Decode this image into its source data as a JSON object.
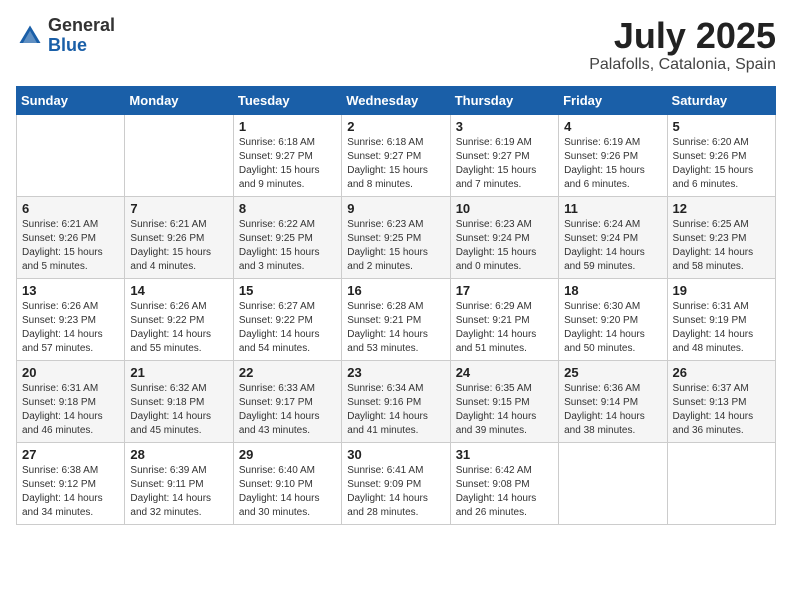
{
  "header": {
    "logo_general": "General",
    "logo_blue": "Blue",
    "month_title": "July 2025",
    "location": "Palafolls, Catalonia, Spain"
  },
  "weekdays": [
    "Sunday",
    "Monday",
    "Tuesday",
    "Wednesday",
    "Thursday",
    "Friday",
    "Saturday"
  ],
  "weeks": [
    [
      {
        "day": "",
        "info": ""
      },
      {
        "day": "",
        "info": ""
      },
      {
        "day": "1",
        "info": "Sunrise: 6:18 AM\nSunset: 9:27 PM\nDaylight: 15 hours\nand 9 minutes."
      },
      {
        "day": "2",
        "info": "Sunrise: 6:18 AM\nSunset: 9:27 PM\nDaylight: 15 hours\nand 8 minutes."
      },
      {
        "day": "3",
        "info": "Sunrise: 6:19 AM\nSunset: 9:27 PM\nDaylight: 15 hours\nand 7 minutes."
      },
      {
        "day": "4",
        "info": "Sunrise: 6:19 AM\nSunset: 9:26 PM\nDaylight: 15 hours\nand 6 minutes."
      },
      {
        "day": "5",
        "info": "Sunrise: 6:20 AM\nSunset: 9:26 PM\nDaylight: 15 hours\nand 6 minutes."
      }
    ],
    [
      {
        "day": "6",
        "info": "Sunrise: 6:21 AM\nSunset: 9:26 PM\nDaylight: 15 hours\nand 5 minutes."
      },
      {
        "day": "7",
        "info": "Sunrise: 6:21 AM\nSunset: 9:26 PM\nDaylight: 15 hours\nand 4 minutes."
      },
      {
        "day": "8",
        "info": "Sunrise: 6:22 AM\nSunset: 9:25 PM\nDaylight: 15 hours\nand 3 minutes."
      },
      {
        "day": "9",
        "info": "Sunrise: 6:23 AM\nSunset: 9:25 PM\nDaylight: 15 hours\nand 2 minutes."
      },
      {
        "day": "10",
        "info": "Sunrise: 6:23 AM\nSunset: 9:24 PM\nDaylight: 15 hours\nand 0 minutes."
      },
      {
        "day": "11",
        "info": "Sunrise: 6:24 AM\nSunset: 9:24 PM\nDaylight: 14 hours\nand 59 minutes."
      },
      {
        "day": "12",
        "info": "Sunrise: 6:25 AM\nSunset: 9:23 PM\nDaylight: 14 hours\nand 58 minutes."
      }
    ],
    [
      {
        "day": "13",
        "info": "Sunrise: 6:26 AM\nSunset: 9:23 PM\nDaylight: 14 hours\nand 57 minutes."
      },
      {
        "day": "14",
        "info": "Sunrise: 6:26 AM\nSunset: 9:22 PM\nDaylight: 14 hours\nand 55 minutes."
      },
      {
        "day": "15",
        "info": "Sunrise: 6:27 AM\nSunset: 9:22 PM\nDaylight: 14 hours\nand 54 minutes."
      },
      {
        "day": "16",
        "info": "Sunrise: 6:28 AM\nSunset: 9:21 PM\nDaylight: 14 hours\nand 53 minutes."
      },
      {
        "day": "17",
        "info": "Sunrise: 6:29 AM\nSunset: 9:21 PM\nDaylight: 14 hours\nand 51 minutes."
      },
      {
        "day": "18",
        "info": "Sunrise: 6:30 AM\nSunset: 9:20 PM\nDaylight: 14 hours\nand 50 minutes."
      },
      {
        "day": "19",
        "info": "Sunrise: 6:31 AM\nSunset: 9:19 PM\nDaylight: 14 hours\nand 48 minutes."
      }
    ],
    [
      {
        "day": "20",
        "info": "Sunrise: 6:31 AM\nSunset: 9:18 PM\nDaylight: 14 hours\nand 46 minutes."
      },
      {
        "day": "21",
        "info": "Sunrise: 6:32 AM\nSunset: 9:18 PM\nDaylight: 14 hours\nand 45 minutes."
      },
      {
        "day": "22",
        "info": "Sunrise: 6:33 AM\nSunset: 9:17 PM\nDaylight: 14 hours\nand 43 minutes."
      },
      {
        "day": "23",
        "info": "Sunrise: 6:34 AM\nSunset: 9:16 PM\nDaylight: 14 hours\nand 41 minutes."
      },
      {
        "day": "24",
        "info": "Sunrise: 6:35 AM\nSunset: 9:15 PM\nDaylight: 14 hours\nand 39 minutes."
      },
      {
        "day": "25",
        "info": "Sunrise: 6:36 AM\nSunset: 9:14 PM\nDaylight: 14 hours\nand 38 minutes."
      },
      {
        "day": "26",
        "info": "Sunrise: 6:37 AM\nSunset: 9:13 PM\nDaylight: 14 hours\nand 36 minutes."
      }
    ],
    [
      {
        "day": "27",
        "info": "Sunrise: 6:38 AM\nSunset: 9:12 PM\nDaylight: 14 hours\nand 34 minutes."
      },
      {
        "day": "28",
        "info": "Sunrise: 6:39 AM\nSunset: 9:11 PM\nDaylight: 14 hours\nand 32 minutes."
      },
      {
        "day": "29",
        "info": "Sunrise: 6:40 AM\nSunset: 9:10 PM\nDaylight: 14 hours\nand 30 minutes."
      },
      {
        "day": "30",
        "info": "Sunrise: 6:41 AM\nSunset: 9:09 PM\nDaylight: 14 hours\nand 28 minutes."
      },
      {
        "day": "31",
        "info": "Sunrise: 6:42 AM\nSunset: 9:08 PM\nDaylight: 14 hours\nand 26 minutes."
      },
      {
        "day": "",
        "info": ""
      },
      {
        "day": "",
        "info": ""
      }
    ]
  ]
}
